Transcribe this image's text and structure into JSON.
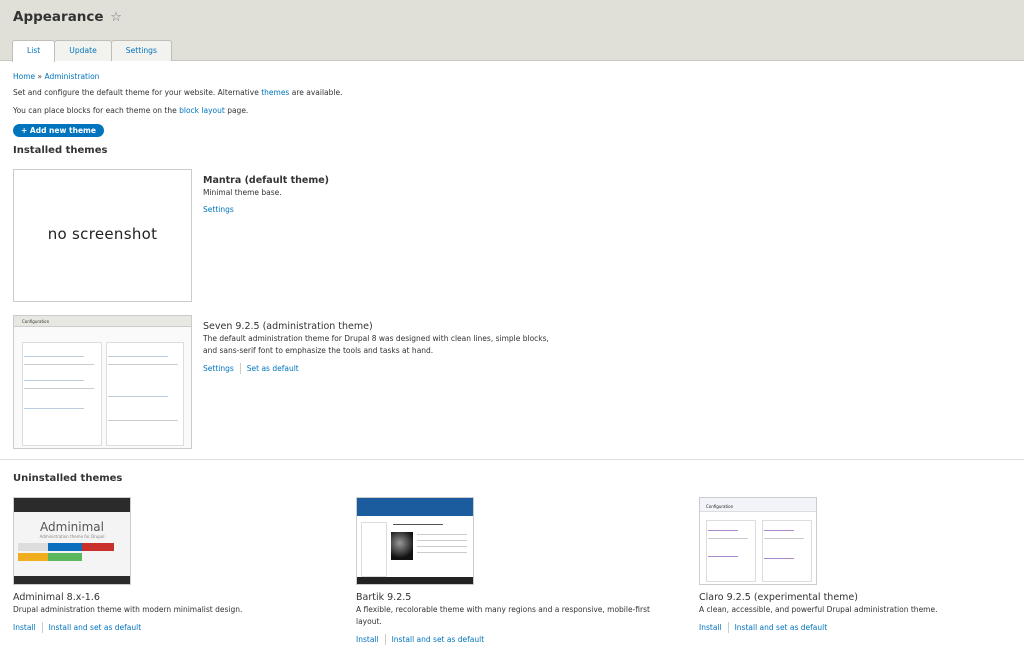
{
  "header": {
    "title": "Appearance",
    "star": "☆",
    "tabs": [
      {
        "label": "List",
        "active": true
      },
      {
        "label": "Update",
        "active": false
      },
      {
        "label": "Settings",
        "active": false
      }
    ]
  },
  "breadcrumb": {
    "home": "Home",
    "separator": "»",
    "admin": "Administration"
  },
  "intro": {
    "line1_before": "Set and configure the default theme for your website. Alternative ",
    "line1_link": "themes",
    "line1_after": " are available.",
    "line2_before": "You can place blocks for each theme on the ",
    "line2_link": "block layout",
    "line2_after": " page."
  },
  "add_button": "+ Add new theme",
  "installed": {
    "heading": "Installed themes",
    "themes": [
      {
        "name": "Mantra (default theme)",
        "description": "Minimal theme base.",
        "screenshot_text": "no screenshot",
        "ops": [
          "Settings"
        ]
      },
      {
        "name": "Seven 9.2.5 (administration theme)",
        "description_line1": "The default administration theme for Drupal 8 was designed with clean lines, simple blocks,",
        "description_line2": "and sans-serif font to emphasize the tools and tasks at hand.",
        "ops": [
          "Settings",
          "Set as default"
        ],
        "screenshot_title": "Configuration"
      }
    ]
  },
  "uninstalled": {
    "heading": "Uninstalled themes",
    "themes": [
      {
        "name": "Adminimal 8.x-1.6",
        "description": "Drupal administration theme with modern minimalist design.",
        "ops": [
          "Install",
          "Install and set as default"
        ],
        "logo_text": "Adminimal",
        "logo_sub": "Administration theme for Drupal"
      },
      {
        "name": "Bartik 9.2.5",
        "description_line1": "A flexible, recolorable theme with many regions and a responsive, mobile-first",
        "description_line2": "layout.",
        "ops": [
          "Install",
          "Install and set as default"
        ]
      },
      {
        "name": "Claro 9.2.5 (experimental theme)",
        "description": "A clean, accessible, and powerful Drupal administration theme.",
        "ops": [
          "Install",
          "Install and set as default"
        ],
        "screenshot_title": "Configuration"
      }
    ]
  },
  "colors": {
    "link": "#0074bd",
    "header_bg": "#e0e0d8",
    "button_bg": "#0074bd"
  }
}
